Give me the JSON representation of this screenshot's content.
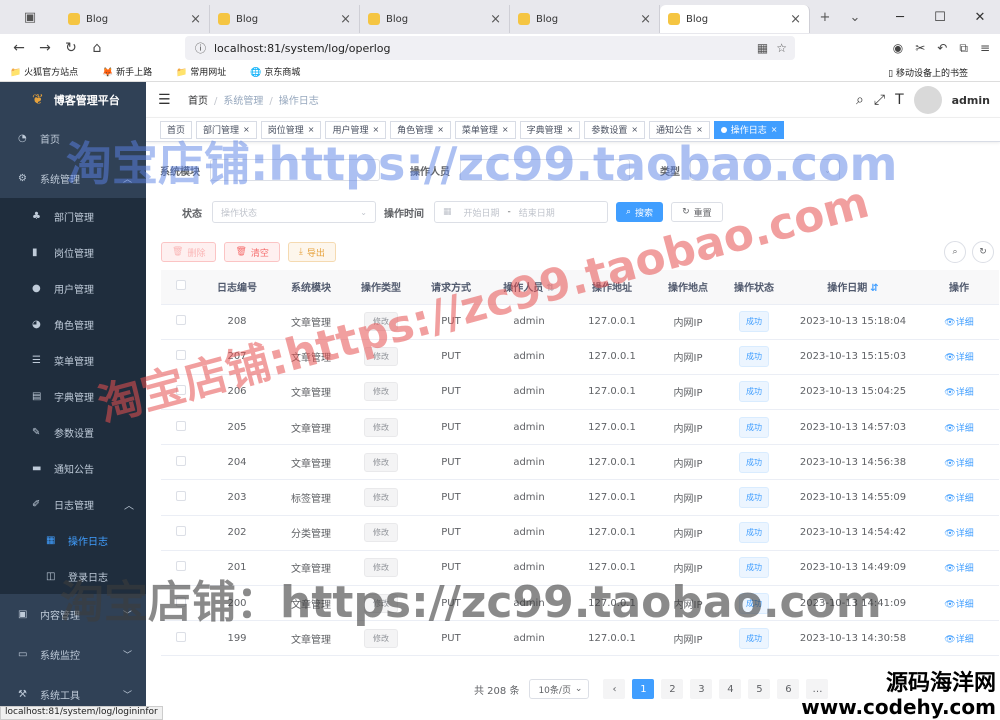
{
  "browser": {
    "tabs": [
      "Blog",
      "Blog",
      "Blog",
      "Blog",
      "Blog"
    ],
    "url": "localhost:81/system/log/operlog",
    "bookmarks": [
      "火狐官方站点",
      "新手上路",
      "常用网址",
      "京东商城"
    ],
    "mobile_bookmarks": "移动设备上的书签",
    "status_url": "localhost:81/system/log/logininfor"
  },
  "sidebar": {
    "title": "博客管理平台",
    "items": [
      {
        "label": "首页",
        "icon": "dashboard-icon"
      },
      {
        "label": "系统管理",
        "icon": "gear-icon"
      },
      {
        "label": "部门管理",
        "icon": "tree-icon"
      },
      {
        "label": "岗位管理",
        "icon": "post-icon"
      },
      {
        "label": "用户管理",
        "icon": "user-icon"
      },
      {
        "label": "角色管理",
        "icon": "peoples-icon"
      },
      {
        "label": "菜单管理",
        "icon": "tree-table-icon"
      },
      {
        "label": "字典管理",
        "icon": "dict-icon"
      },
      {
        "label": "参数设置",
        "icon": "edit-icon"
      },
      {
        "label": "通知公告",
        "icon": "message-icon"
      },
      {
        "label": "日志管理",
        "icon": "log-icon"
      },
      {
        "label": "操作日志",
        "icon": "form-icon"
      },
      {
        "label": "登录日志",
        "icon": "logininfor-icon"
      },
      {
        "label": "内容管理",
        "icon": "content-icon"
      },
      {
        "label": "系统监控",
        "icon": "monitor-icon"
      },
      {
        "label": "系统工具",
        "icon": "tool-icon"
      }
    ]
  },
  "navbar": {
    "breadcrumb": [
      "首页",
      "系统管理",
      "操作日志"
    ],
    "username": "admin"
  },
  "tags": [
    "首页",
    "部门管理",
    "岗位管理",
    "用户管理",
    "角色管理",
    "菜单管理",
    "字典管理",
    "参数设置",
    "通知公告",
    "操作日志"
  ],
  "search": {
    "module_label": "系统模块",
    "operator_label": "操作人员",
    "type_label": "类型",
    "status_label": "状态",
    "status_placeholder": "操作状态",
    "time_label": "操作时间",
    "start_placeholder": "开始日期",
    "end_placeholder": "结束日期",
    "search_btn": "搜索",
    "reset_btn": "重置"
  },
  "actions": {
    "delete": "删除",
    "clear": "清空",
    "export": "导出"
  },
  "table": {
    "columns": [
      "日志编号",
      "系统模块",
      "操作类型",
      "请求方式",
      "操作人员",
      "操作地址",
      "操作地点",
      "操作状态",
      "操作日期",
      "操作"
    ],
    "rows": [
      {
        "id": "208",
        "module": "文章管理",
        "type": "修改",
        "method": "PUT",
        "user": "admin",
        "ip": "127.0.0.1",
        "loc": "内网IP",
        "status": "成功",
        "date": "2023-10-13 15:18:04",
        "op": "详细"
      },
      {
        "id": "207",
        "module": "文章管理",
        "type": "修改",
        "method": "PUT",
        "user": "admin",
        "ip": "127.0.0.1",
        "loc": "内网IP",
        "status": "成功",
        "date": "2023-10-13 15:15:03",
        "op": "详细"
      },
      {
        "id": "206",
        "module": "文章管理",
        "type": "修改",
        "method": "PUT",
        "user": "admin",
        "ip": "127.0.0.1",
        "loc": "内网IP",
        "status": "成功",
        "date": "2023-10-13 15:04:25",
        "op": "详细"
      },
      {
        "id": "205",
        "module": "文章管理",
        "type": "修改",
        "method": "PUT",
        "user": "admin",
        "ip": "127.0.0.1",
        "loc": "内网IP",
        "status": "成功",
        "date": "2023-10-13 14:57:03",
        "op": "详细"
      },
      {
        "id": "204",
        "module": "文章管理",
        "type": "修改",
        "method": "PUT",
        "user": "admin",
        "ip": "127.0.0.1",
        "loc": "内网IP",
        "status": "成功",
        "date": "2023-10-13 14:56:38",
        "op": "详细"
      },
      {
        "id": "203",
        "module": "标签管理",
        "type": "修改",
        "method": "PUT",
        "user": "admin",
        "ip": "127.0.0.1",
        "loc": "内网IP",
        "status": "成功",
        "date": "2023-10-13 14:55:09",
        "op": "详细"
      },
      {
        "id": "202",
        "module": "分类管理",
        "type": "修改",
        "method": "PUT",
        "user": "admin",
        "ip": "127.0.0.1",
        "loc": "内网IP",
        "status": "成功",
        "date": "2023-10-13 14:54:42",
        "op": "详细"
      },
      {
        "id": "201",
        "module": "文章管理",
        "type": "修改",
        "method": "PUT",
        "user": "admin",
        "ip": "127.0.0.1",
        "loc": "内网IP",
        "status": "成功",
        "date": "2023-10-13 14:49:09",
        "op": "详细"
      },
      {
        "id": "200",
        "module": "文章管理",
        "type": "修改",
        "method": "PUT",
        "user": "admin",
        "ip": "127.0.0.1",
        "loc": "内网IP",
        "status": "成功",
        "date": "2023-10-13 14:41:09",
        "op": "详细"
      },
      {
        "id": "199",
        "module": "文章管理",
        "type": "修改",
        "method": "PUT",
        "user": "admin",
        "ip": "127.0.0.1",
        "loc": "内网IP",
        "status": "成功",
        "date": "2023-10-13 14:30:58",
        "op": "详细"
      }
    ]
  },
  "pagination": {
    "total": "共 208 条",
    "page_size": "10条/页",
    "pages": [
      "1",
      "2",
      "3",
      "4",
      "5",
      "6"
    ],
    "current": "1"
  },
  "watermarks": {
    "line1": "淘宝店铺:https://zc99.taobao.com",
    "line2": "淘宝店铺:https://zc99.taobao.com",
    "line3": "淘宝店铺：https://zc99.taobao.com",
    "brand_cn": "源码海洋网",
    "brand_url": "www.codehy.com"
  },
  "colors": {
    "primary": "#409eff",
    "sidebar": "#304156",
    "submenu": "#1f2d3d",
    "danger": "#f56c6c",
    "warning": "#e6a23c"
  }
}
